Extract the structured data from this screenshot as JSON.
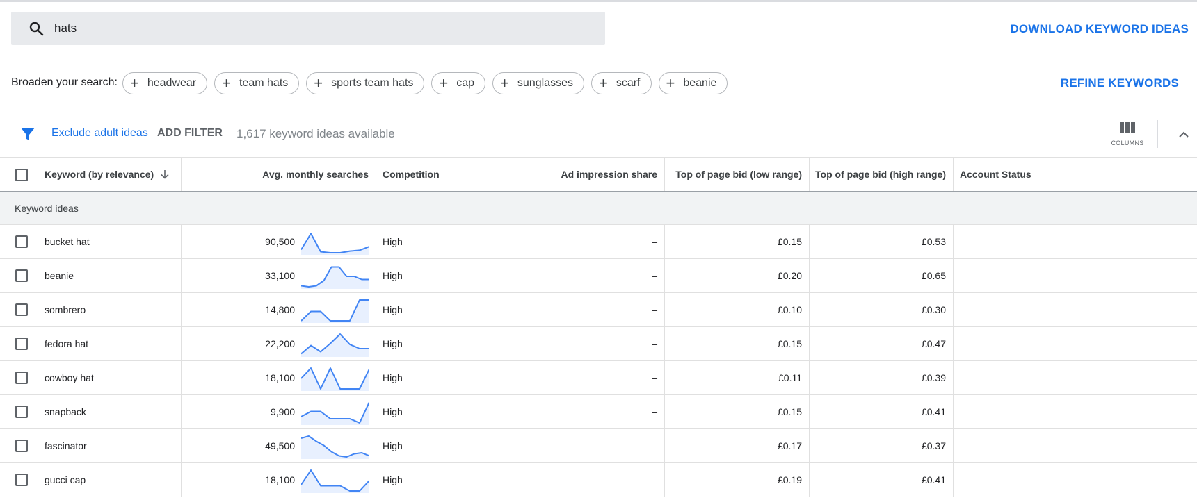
{
  "search": {
    "query": "hats",
    "icon": "search-icon"
  },
  "download_label": "DOWNLOAD KEYWORD IDEAS",
  "broaden": {
    "label": "Broaden your search:",
    "chips": [
      "headwear",
      "team hats",
      "sports team hats",
      "cap",
      "sunglasses",
      "scarf",
      "beanie"
    ],
    "refine_label": "REFINE KEYWORDS"
  },
  "filters": {
    "exclude_adult_label": "Exclude adult ideas",
    "add_filter_label": "ADD FILTER",
    "available_text": "1,617 keyword ideas available",
    "columns_label": "COLUMNS"
  },
  "colors": {
    "accent": "#1a73e8",
    "sparkline": "#4285f4",
    "sparkline_fill": "#e8f0fe"
  },
  "table": {
    "headers": {
      "keyword": "Keyword (by relevance)",
      "searches": "Avg. monthly searches",
      "competition": "Competition",
      "impression": "Ad impression share",
      "bid_low": "Top of page bid (low range)",
      "bid_high": "Top of page bid (high range)",
      "status": "Account Status"
    },
    "section_label": "Keyword ideas",
    "rows": [
      {
        "keyword": "bucket hat",
        "searches": "90,500",
        "trend": [
          0.15,
          0.92,
          0.05,
          0.0,
          0.0,
          0.08,
          0.12,
          0.3
        ],
        "competition": "High",
        "impression": "–",
        "bid_low": "£0.15",
        "bid_high": "£0.53",
        "status": ""
      },
      {
        "keyword": "beanie",
        "searches": "33,100",
        "trend": [
          0.05,
          0.0,
          0.05,
          0.3,
          0.95,
          0.95,
          0.5,
          0.5,
          0.35,
          0.35
        ],
        "competition": "High",
        "impression": "–",
        "bid_low": "£0.20",
        "bid_high": "£0.65",
        "status": ""
      },
      {
        "keyword": "sombrero",
        "searches": "14,800",
        "trend": [
          0.0,
          0.45,
          0.45,
          0.0,
          0.0,
          0.0,
          1.0,
          1.0
        ],
        "competition": "High",
        "impression": "–",
        "bid_low": "£0.10",
        "bid_high": "£0.30",
        "status": ""
      },
      {
        "keyword": "fedora hat",
        "searches": "22,200",
        "trend": [
          0.05,
          0.45,
          0.15,
          0.55,
          1.0,
          0.5,
          0.3,
          0.3
        ],
        "competition": "High",
        "impression": "–",
        "bid_low": "£0.15",
        "bid_high": "£0.47",
        "status": ""
      },
      {
        "keyword": "cowboy hat",
        "searches": "18,100",
        "trend": [
          0.5,
          1.0,
          0.0,
          1.0,
          0.0,
          0.0,
          0.0,
          0.95
        ],
        "competition": "High",
        "impression": "–",
        "bid_low": "£0.11",
        "bid_high": "£0.39",
        "status": ""
      },
      {
        "keyword": "snapback",
        "searches": "9,900",
        "trend": [
          0.3,
          0.55,
          0.55,
          0.2,
          0.2,
          0.2,
          0.0,
          1.0
        ],
        "competition": "High",
        "impression": "–",
        "bid_low": "£0.15",
        "bid_high": "£0.41",
        "status": ""
      },
      {
        "keyword": "fascinator",
        "searches": "49,500",
        "trend": [
          0.9,
          1.0,
          0.75,
          0.55,
          0.25,
          0.05,
          0.0,
          0.15,
          0.2,
          0.05
        ],
        "competition": "High",
        "impression": "–",
        "bid_low": "£0.17",
        "bid_high": "£0.37",
        "status": ""
      },
      {
        "keyword": "gucci cap",
        "searches": "18,100",
        "trend": [
          0.3,
          1.0,
          0.25,
          0.25,
          0.25,
          0.0,
          0.0,
          0.5
        ],
        "competition": "High",
        "impression": "–",
        "bid_low": "£0.19",
        "bid_high": "£0.41",
        "status": ""
      }
    ]
  }
}
